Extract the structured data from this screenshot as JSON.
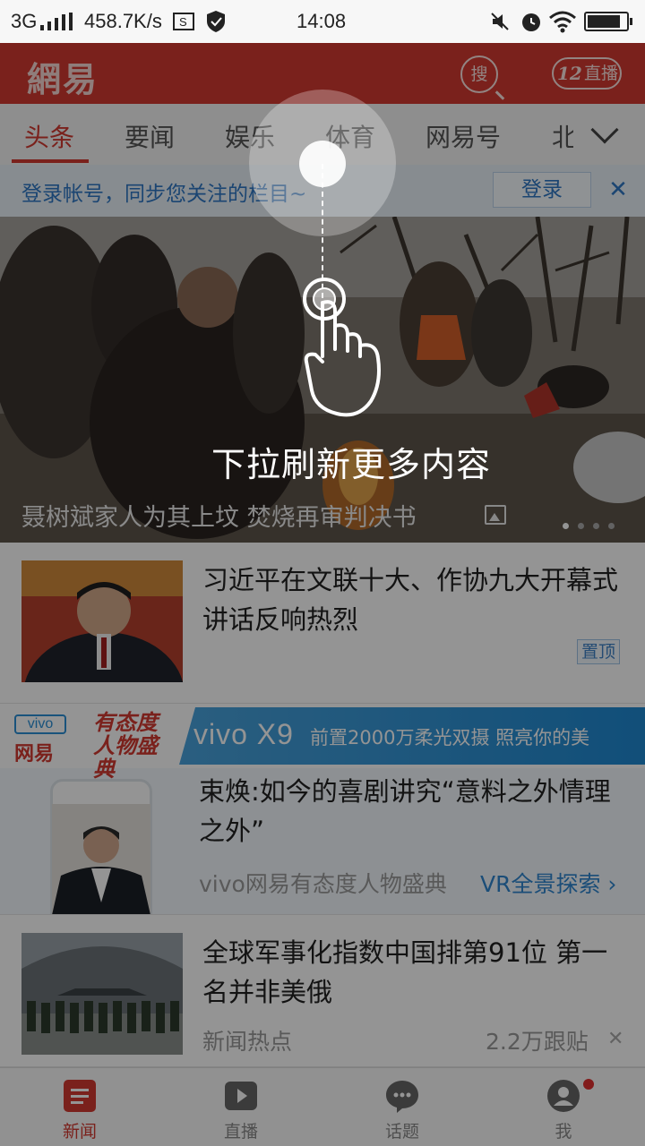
{
  "status_bar": {
    "network": "3G",
    "speed": "458.7K/s",
    "time": "14:08",
    "battery_level": 0.85
  },
  "app_header": {
    "logo": "網易",
    "search_label": "搜",
    "live_count": "12",
    "live_label": "直播",
    "brand_color": "#d33a31"
  },
  "tabs": {
    "items": [
      {
        "label": "头条",
        "active": true
      },
      {
        "label": "要闻"
      },
      {
        "label": "娱乐"
      },
      {
        "label": "体育"
      },
      {
        "label": "网易号"
      },
      {
        "label": "北"
      }
    ]
  },
  "login_bar": {
    "text": "登录帐号，同步您关注的栏目~",
    "button": "登录",
    "close": "✕"
  },
  "hero": {
    "caption": "聂树斌家人为其上坟 焚烧再审判决书",
    "pages": 4,
    "current_page": 1
  },
  "overlay": {
    "hint_text": "下拉刷新更多内容"
  },
  "news": [
    {
      "title": "习近平在文联十大、作协九大开幕式讲话反响热烈",
      "badge": "置顶"
    },
    {
      "title": "全球军事化指数中国排第91位 第一名并非美俄",
      "source": "新闻热点",
      "comments": "2.2万跟贴",
      "dismiss": "✕"
    }
  ],
  "ad": {
    "vivo_logo": "vivo",
    "netease": "网易",
    "slogan": "有态度人物盛典",
    "model": "vivo X9",
    "feature": "前置2000万柔光双摄 照亮你的美",
    "title": "束焕:如今的喜剧讲究“意料之外情理之外”",
    "source": "vivo网易有态度人物盛典",
    "vr_label": "VR全景探索 ›"
  },
  "bottom_nav": {
    "items": [
      {
        "label": "新闻",
        "icon": "news-icon",
        "active": true
      },
      {
        "label": "直播",
        "icon": "live-play-icon"
      },
      {
        "label": "话题",
        "icon": "topic-chat-icon"
      },
      {
        "label": "我",
        "icon": "profile-icon",
        "has_notification": true
      }
    ]
  }
}
